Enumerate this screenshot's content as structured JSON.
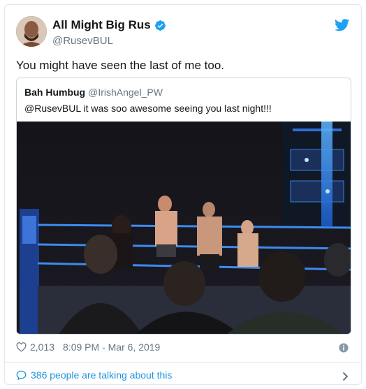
{
  "author": {
    "display_name": "All Might Big Rus",
    "handle": "@RusevBUL",
    "verified": true
  },
  "tweet": {
    "text": "You might have seen the last of me too."
  },
  "quoted_tweet": {
    "display_name": "Bah Humbug",
    "handle": "@IrishAngel_PW",
    "text": "@RusevBUL it was soo awesome seeing you last night!!!",
    "media": "photo of a wrestling match with wrestlers in the ring and crowd in foreground"
  },
  "meta": {
    "like_count": "2,013",
    "timestamp": "8:09 PM - Mar 6, 2019"
  },
  "footer": {
    "talking_text": "386 people are talking about this"
  },
  "colors": {
    "brand_blue": "#1da1f2",
    "link_blue": "#1b95e0",
    "secondary_text": "#657786",
    "border": "#e1e8ed"
  },
  "icons": [
    "verified-badge-icon",
    "twitter-bird-icon",
    "heart-icon",
    "info-icon",
    "speech-bubble-icon",
    "chevron-right-icon"
  ]
}
